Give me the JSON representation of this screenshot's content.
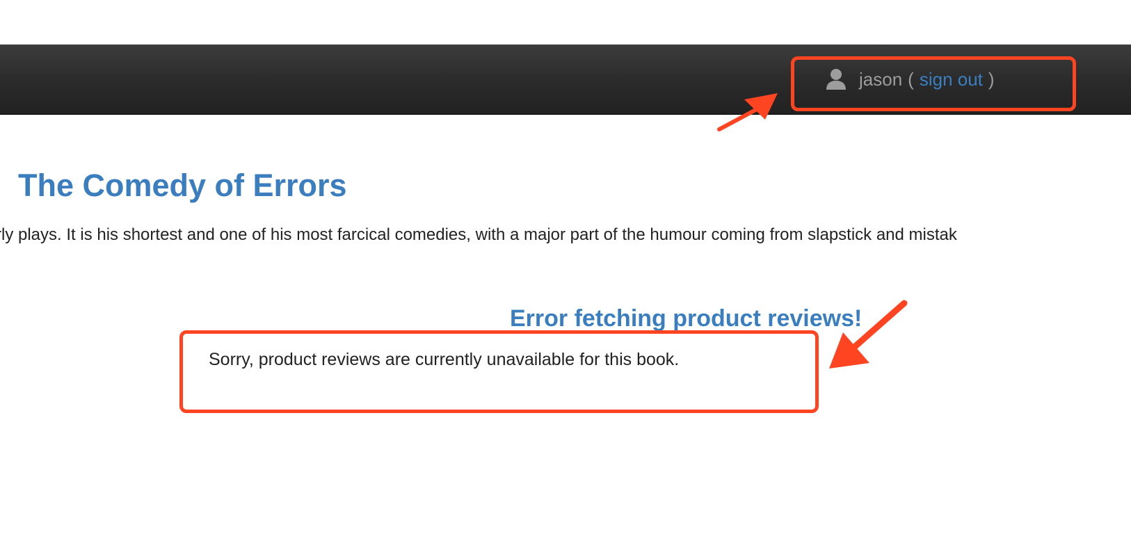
{
  "navbar": {
    "user_icon": "user-icon",
    "username": "jason",
    "open_paren": "(",
    "signout_label": "sign out",
    "close_paren": ")"
  },
  "product": {
    "title": "The Comedy of Errors",
    "summary": "rly plays. It is his shortest and one of his most farcical comedies, with a major part of the humour coming from slapstick and mistak"
  },
  "reviews": {
    "error_heading": "Error fetching product reviews!",
    "error_message": "Sorry, product reviews are currently unavailable for this book."
  },
  "annotations": {
    "color": "#ff4422"
  }
}
